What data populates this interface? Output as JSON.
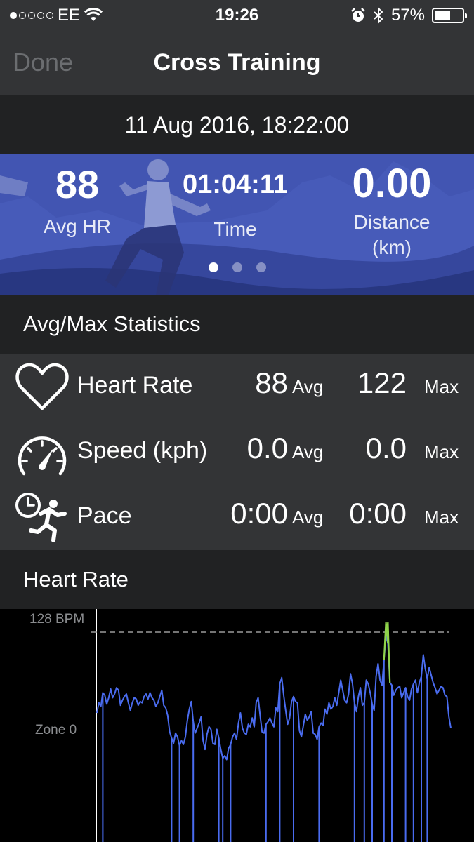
{
  "status_bar": {
    "carrier": "EE",
    "signal_filled": 1,
    "signal_total": 5,
    "time": "19:26",
    "battery": "57%",
    "battery_level": 0.57,
    "icons": [
      "wifi-icon",
      "alarm-icon",
      "bluetooth-icon",
      "battery-icon"
    ]
  },
  "nav": {
    "done_label": "Done",
    "title": "Cross Training"
  },
  "session": {
    "datetime": "11 Aug 2016, 18:22:00"
  },
  "hero": {
    "stats": [
      {
        "value": "88",
        "label": "Avg HR"
      },
      {
        "value": "01:04:11",
        "label": "Time"
      },
      {
        "value": "0.00",
        "label": "Distance",
        "unit": "(km)"
      }
    ],
    "page_count": 3,
    "active_page": 1
  },
  "stats_section": {
    "title": "Avg/Max Statistics",
    "rows": [
      {
        "icon": "heart-icon",
        "name": "Heart Rate",
        "avg": "88",
        "avg_label": "Avg",
        "max": "122",
        "max_label": "Max"
      },
      {
        "icon": "speedometer-icon",
        "name": "Speed (kph)",
        "avg": "0.0",
        "avg_label": "Avg",
        "max": "0.0",
        "max_label": "Max"
      },
      {
        "icon": "pace-runner-icon",
        "name": "Pace",
        "avg": "0:00",
        "avg_label": "Avg",
        "max": "0:00",
        "max_label": "Max"
      }
    ]
  },
  "heart_rate_section": {
    "title": "Heart Rate",
    "max_label": "128 BPM",
    "zone_label": "Zone 0"
  },
  "chart_data": {
    "type": "line",
    "title": "Heart Rate",
    "ylabel": "BPM",
    "reference_line": "128 BPM",
    "zone_label": "Zone 0",
    "grid": false,
    "colors": {
      "line": "#4a6cf0",
      "peak": "#8fd34a",
      "reference": "#9a9a9a"
    },
    "series": [
      {
        "values": [
          64,
          72,
          69,
          80,
          78,
          71,
          76,
          83,
          76,
          79,
          84,
          82,
          70,
          74,
          77,
          79,
          72,
          66,
          72,
          76,
          75,
          70,
          73,
          72,
          77,
          79,
          75,
          80,
          76,
          74,
          69,
          72,
          77,
          82,
          70,
          68,
          62,
          49,
          44,
          40,
          48,
          45,
          38,
          42,
          39,
          45,
          58,
          67,
          73,
          57,
          48,
          52,
          56,
          61,
          42,
          35,
          47,
          53,
          51,
          40,
          39,
          51,
          44,
          35,
          28,
          30,
          27,
          36,
          39,
          45,
          48,
          43,
          56,
          64,
          52,
          48,
          47,
          55,
          53,
          60,
          53,
          72,
          76,
          62,
          49,
          48,
          55,
          57,
          60,
          56,
          53,
          68,
          65,
          87,
          92,
          78,
          66,
          55,
          60,
          73,
          77,
          73,
          72,
          50,
          45,
          54,
          63,
          58,
          61,
          65,
          48,
          47,
          43,
          53,
          56,
          54,
          67,
          63,
          72,
          67,
          69,
          76,
          70,
          80,
          90,
          82,
          74,
          72,
          79,
          95,
          87,
          72,
          65,
          77,
          84,
          70,
          72,
          90,
          87,
          80,
          71,
          66,
          93,
          103,
          90,
          86,
          106,
          125,
          119,
          88,
          86,
          78,
          82,
          84,
          85,
          76,
          80,
          84,
          77,
          74,
          83,
          87,
          90,
          80,
          88,
          93,
          110,
          99,
          91,
          100,
          94,
          88,
          84,
          79,
          82,
          85,
          84,
          78,
          77,
          61,
          52
        ]
      }
    ],
    "dropouts_at": [
      3,
      38,
      42,
      49,
      62,
      64,
      68,
      86,
      93,
      100,
      113,
      131,
      136,
      140,
      146,
      150,
      157,
      161,
      165,
      168
    ]
  }
}
